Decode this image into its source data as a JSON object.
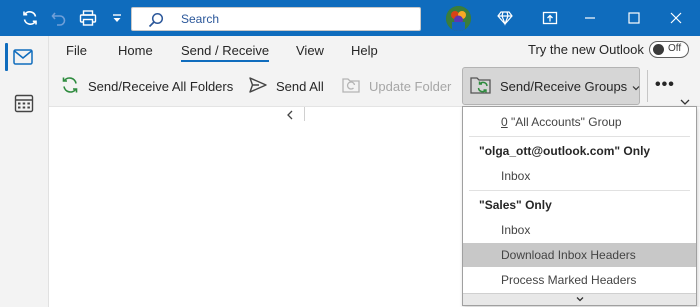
{
  "titlebar": {
    "search_placeholder": "Search",
    "colors": {
      "background": "#0f6cbd"
    }
  },
  "ribbon": {
    "tabs": [
      {
        "label": "File"
      },
      {
        "label": "Home"
      },
      {
        "label": "Send / Receive",
        "active": true
      },
      {
        "label": "View"
      },
      {
        "label": "Help"
      }
    ],
    "try_new": {
      "label": "Try the new Outlook",
      "toggle": "Off"
    },
    "commands": {
      "send_receive_all": "Send/Receive All Folders",
      "send_all": "Send All",
      "update_folder": "Update Folder",
      "send_receive_groups": "Send/Receive Groups"
    }
  },
  "menu": {
    "all_accounts_num": "0",
    "all_accounts_rest": " \"All Accounts\" Group",
    "account1_header": "\"olga_ott@outlook.com\" Only",
    "account1_inbox": "Inbox",
    "account2_header": "\"Sales\" Only",
    "account2_inbox": "Inbox",
    "download_headers": "Download Inbox Headers",
    "process_marked": "Process Marked Headers"
  }
}
